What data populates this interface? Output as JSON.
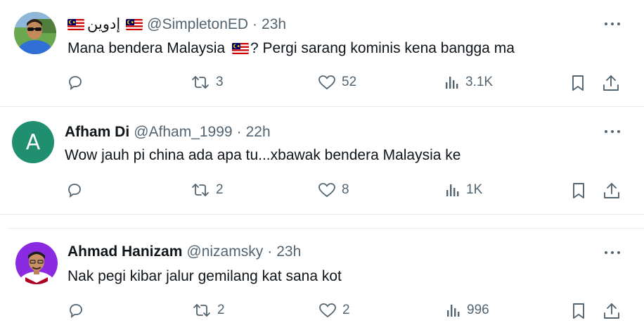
{
  "tweets": [
    {
      "display_name": "إدوين",
      "handle": "@SimpletonED",
      "separator": "·",
      "time": "23h",
      "text_before_flag": "Mana bendera Malaysia",
      "text_after_flag": "? Pergi sarang kominis kena bangga ma",
      "replies": "",
      "reposts": "3",
      "likes": "52",
      "views": "3.1K",
      "avatar_icon": "photo-avatar-sunglasses"
    },
    {
      "display_name": "Afham Di",
      "handle": "@Afham_1999",
      "separator": "·",
      "time": "22h",
      "text": "Wow jauh pi china ada apa tu...xbawak bendera Malaysia ke",
      "replies": "",
      "reposts": "2",
      "likes": "8",
      "views": "1K",
      "avatar_letter": "A",
      "avatar_color": "#1f8f6f"
    },
    {
      "display_name": "Ahmad Hanizam",
      "handle": "@nizamsky",
      "separator": "·",
      "time": "23h",
      "text": "Nak pegi kibar jalur gemilang kat sana kot",
      "replies": "",
      "reposts": "2",
      "likes": "2",
      "views": "996",
      "avatar_icon": "photo-avatar-purple"
    }
  ],
  "colors": {
    "text": "#0f1419",
    "secondary": "#536471",
    "divider": "#e7e9ea"
  }
}
